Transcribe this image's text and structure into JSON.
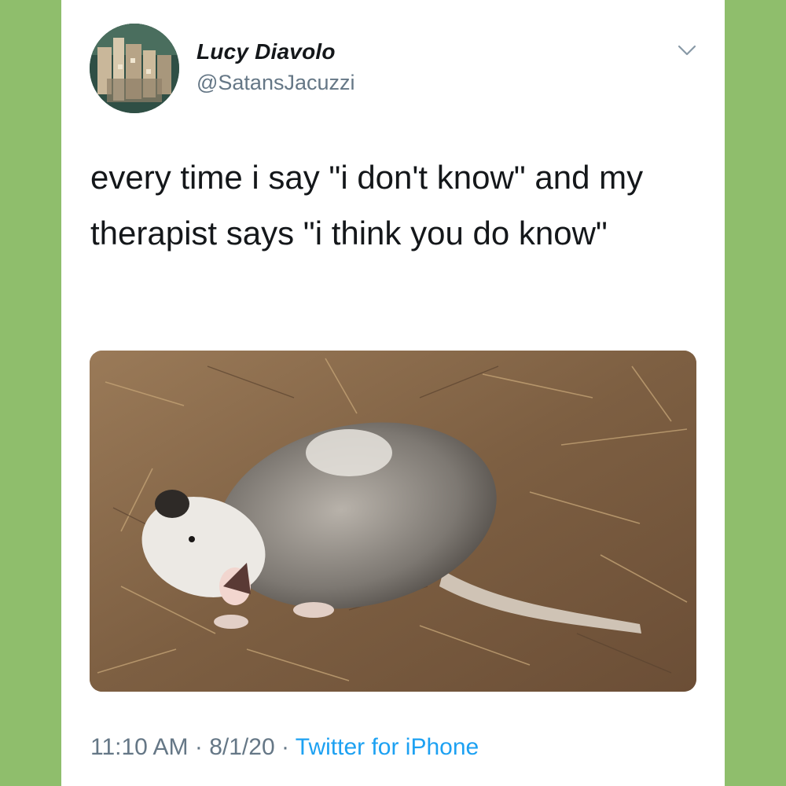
{
  "tweet": {
    "author_name": "Lucy Diavolo",
    "author_handle": "@SatansJacuzzi",
    "text": "every time i say \"i don't know\" and my therapist says \"i think you do know\"",
    "time": "11:10 AM",
    "date": "8/1/20",
    "separator": "·",
    "source": "Twitter for iPhone"
  },
  "icons": {
    "menu": "chevron-down-icon",
    "avatar": "avatar-image",
    "media": "opossum-photo"
  },
  "colors": {
    "background": "#8fbe6c",
    "card": "#ffffff",
    "text": "#14171a",
    "muted": "#657786",
    "link": "#1da1f2"
  }
}
